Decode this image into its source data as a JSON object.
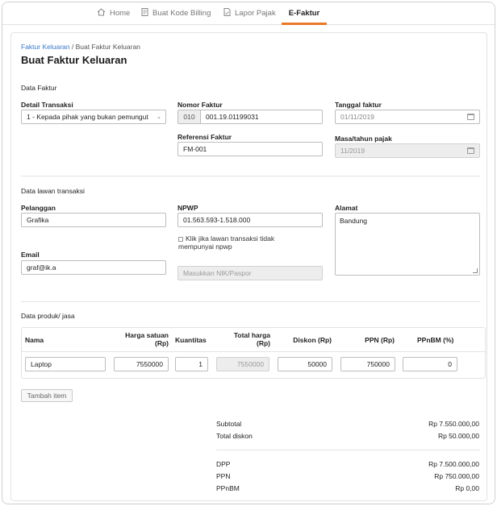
{
  "nav": {
    "tabs": [
      {
        "label": "Home",
        "icon": "home-icon"
      },
      {
        "label": "Buat Kode Billing",
        "icon": "document-icon"
      },
      {
        "label": "Lapor Pajak",
        "icon": "report-icon"
      },
      {
        "label": "E-Faktur",
        "icon": ""
      }
    ],
    "active_tab": "E-Faktur",
    "accent_color": "#e8782a"
  },
  "breadcrumb": {
    "link": "Faktur Keluaran",
    "separator": " / ",
    "current": "Buat Faktur Keluaran"
  },
  "page_title": "Buat Faktur Keluaran",
  "data_faktur": {
    "section_title": "Data Faktur",
    "detail_transaksi": {
      "label": "Detail Transaksi",
      "value": "1 - Kepada pihak yang bukan pemungut"
    },
    "nomor_faktur": {
      "label": "Nomor Faktur",
      "prefix": "010",
      "value": "001.19.01199031"
    },
    "tanggal_faktur": {
      "label": "Tanggal faktur",
      "value": "01/11/2019"
    },
    "referensi_faktur": {
      "label": "Referensi Faktur",
      "value": "FM-001"
    },
    "masa_tahun": {
      "label": "Masa/tahun pajak",
      "value": "11/2019"
    }
  },
  "data_lawan": {
    "section_title": "Data lawan transaksi",
    "pelanggan": {
      "label": "Pelanggan",
      "value": "Grafika"
    },
    "npwp": {
      "label": "NPWP",
      "value": "01.563.593-1.518.000"
    },
    "no_npwp_checkbox": "Klik jika lawan transaksi tidak mempunyai npwp",
    "nik_placeholder": "Masukkan NIK/Paspor",
    "alamat": {
      "label": "Alamat",
      "value": "Bandung"
    },
    "email": {
      "label": "Email",
      "value": "graf@ik.a"
    }
  },
  "produk": {
    "section_title": "Data produk/ jasa",
    "headers": {
      "nama": "Nama",
      "harga": "Harga satuan (Rp)",
      "kuantitas": "Kuantitas",
      "total": "Total harga (Rp)",
      "diskon": "Diskon (Rp)",
      "ppn": "PPN (Rp)",
      "ppnbm": "PPnBM (%)"
    },
    "row": {
      "nama": "Laptop",
      "harga": "7550000",
      "kuantitas": "1",
      "total": "7550000",
      "diskon": "50000",
      "ppn": "750000",
      "ppnbm": "0"
    },
    "add_button": "Tambah item"
  },
  "summary": {
    "subtotal": {
      "label": "Subtotal",
      "value": "Rp 7.550.000,00"
    },
    "total_diskon": {
      "label": "Total diskon",
      "value": "Rp 50.000,00"
    },
    "dpp": {
      "label": "DPP",
      "value": "Rp 7.500.000,00"
    },
    "ppn": {
      "label": "PPN",
      "value": "Rp 750.000,00"
    },
    "ppnbm": {
      "label": "PPnBM",
      "value": "Rp 0,00"
    }
  }
}
